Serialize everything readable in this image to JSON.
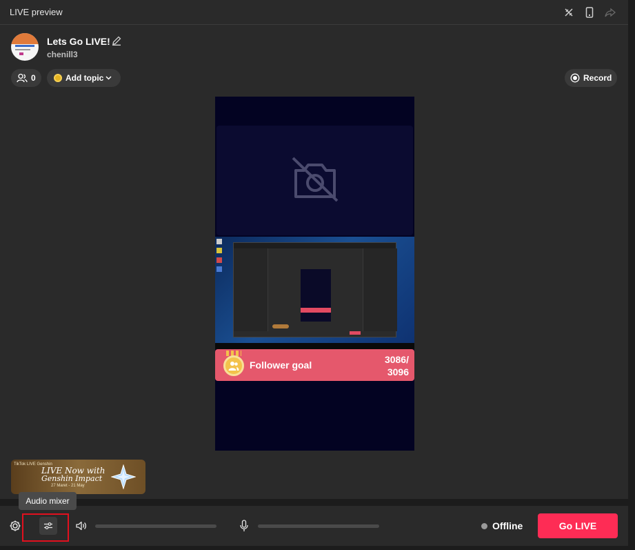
{
  "window": {
    "title": "LIVE preview"
  },
  "stream": {
    "title": "Lets Go LIVE!",
    "username": "chenill3"
  },
  "controls": {
    "viewer_count": "0",
    "add_topic": "Add topic",
    "record": "Record"
  },
  "follower_goal": {
    "label": "Follower goal",
    "count_line1": "3086/",
    "count_line2": "3096"
  },
  "banner": {
    "brand": "TikTok LIVE  Genshin",
    "line1": "LIVE Now with",
    "line2": "Genshin Impact",
    "dates": "27 Maret - 21 May"
  },
  "tooltip": {
    "text": "Audio mixer"
  },
  "bottombar": {
    "status": "Offline",
    "go_live": "Go LIVE"
  },
  "colors": {
    "accent": "#fe2c55",
    "goal": "#e5586c",
    "highlight": "#e3101e"
  }
}
